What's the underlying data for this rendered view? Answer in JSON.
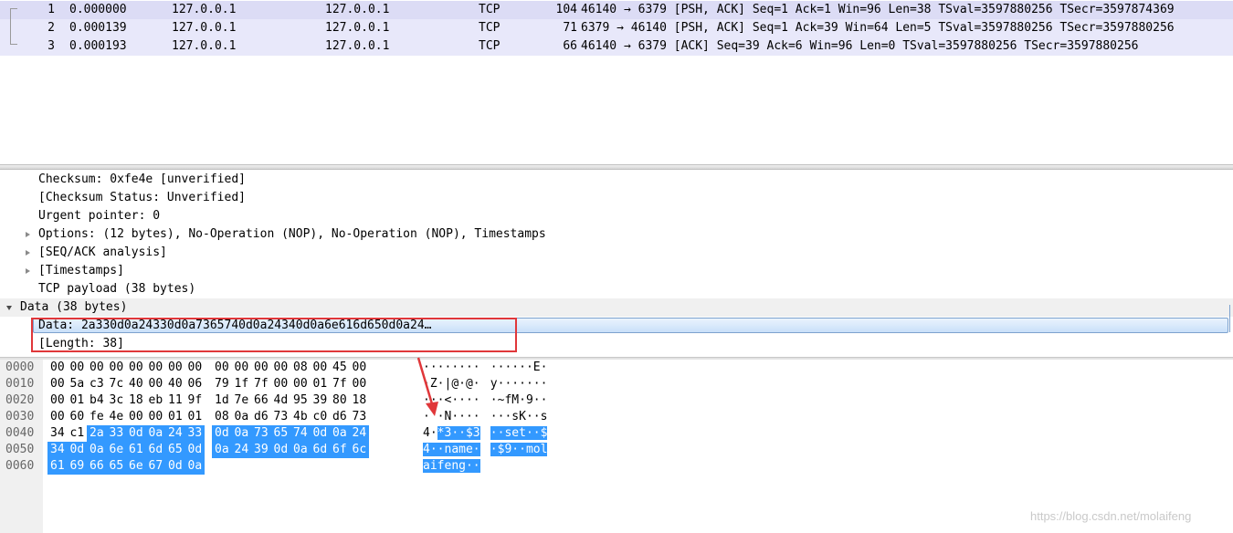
{
  "packets": [
    {
      "no": "1",
      "time": "0.000000",
      "src": "127.0.0.1",
      "dst": "127.0.0.1",
      "proto": "TCP",
      "len": "104",
      "info": "46140 → 6379 [PSH, ACK] Seq=1 Ack=1 Win=96 Len=38 TSval=3597880256 TSecr=3597874369"
    },
    {
      "no": "2",
      "time": "0.000139",
      "src": "127.0.0.1",
      "dst": "127.0.0.1",
      "proto": "TCP",
      "len": "71",
      "info": "6379 → 46140 [PSH, ACK] Seq=1 Ack=39 Win=64 Len=5 TSval=3597880256 TSecr=3597880256"
    },
    {
      "no": "3",
      "time": "0.000193",
      "src": "127.0.0.1",
      "dst": "127.0.0.1",
      "proto": "TCP",
      "len": "66",
      "info": "46140 → 6379 [ACK] Seq=39 Ack=6 Win=96 Len=0 TSval=3597880256 TSecr=3597880256"
    }
  ],
  "details": [
    {
      "text": "Checksum: 0xfe4e [unverified]"
    },
    {
      "text": "[Checksum Status: Unverified]"
    },
    {
      "text": "Urgent pointer: 0"
    },
    {
      "text": "Options: (12 bytes), No-Operation (NOP), No-Operation (NOP), Timestamps"
    },
    {
      "text": "[SEQ/ACK analysis]"
    },
    {
      "text": "[Timestamps]"
    },
    {
      "text": "TCP payload (38 bytes)"
    },
    {
      "text": "Data (38 bytes)"
    },
    {
      "text": "Data: 2a330d0a24330d0a7365740d0a24340d0a6e616d650d0a24…"
    },
    {
      "text": "[Length: 38]"
    }
  ],
  "bytes": {
    "offsets": [
      "0000",
      "0010",
      "0020",
      "0030",
      "0040",
      "0050",
      "0060"
    ],
    "hex": [
      [
        "00",
        "00",
        "00",
        "00",
        "00",
        "00",
        "00",
        "00",
        "00",
        "00",
        "00",
        "00",
        "08",
        "00",
        "45",
        "00"
      ],
      [
        "00",
        "5a",
        "c3",
        "7c",
        "40",
        "00",
        "40",
        "06",
        "79",
        "1f",
        "7f",
        "00",
        "00",
        "01",
        "7f",
        "00"
      ],
      [
        "00",
        "01",
        "b4",
        "3c",
        "18",
        "eb",
        "11",
        "9f",
        "1d",
        "7e",
        "66",
        "4d",
        "95",
        "39",
        "80",
        "18"
      ],
      [
        "00",
        "60",
        "fe",
        "4e",
        "00",
        "00",
        "01",
        "01",
        "08",
        "0a",
        "d6",
        "73",
        "4b",
        "c0",
        "d6",
        "73"
      ],
      [
        "34",
        "c1",
        "2a",
        "33",
        "0d",
        "0a",
        "24",
        "33",
        "0d",
        "0a",
        "73",
        "65",
        "74",
        "0d",
        "0a",
        "24"
      ],
      [
        "34",
        "0d",
        "0a",
        "6e",
        "61",
        "6d",
        "65",
        "0d",
        "0a",
        "24",
        "39",
        "0d",
        "0a",
        "6d",
        "6f",
        "6c"
      ],
      [
        "61",
        "69",
        "66",
        "65",
        "6e",
        "67",
        "0d",
        "0a"
      ]
    ],
    "ascii": [
      [
        "········",
        "······E·"
      ],
      [
        "·Z·|@·@·",
        "y·······"
      ],
      [
        "···<····",
        "·~fM·9··"
      ],
      [
        "·`·N····",
        "···sK··s"
      ],
      [
        "4·*3··$3",
        "··set··$"
      ],
      [
        "4··name·",
        "·$9··mol"
      ],
      [
        "aifeng··",
        ""
      ]
    ]
  },
  "watermark": "https://blog.csdn.net/molaifeng",
  "colors": {
    "selection": "#3399ff",
    "annotation": "#e0373a",
    "row_highlight": "#dcdcf5"
  }
}
